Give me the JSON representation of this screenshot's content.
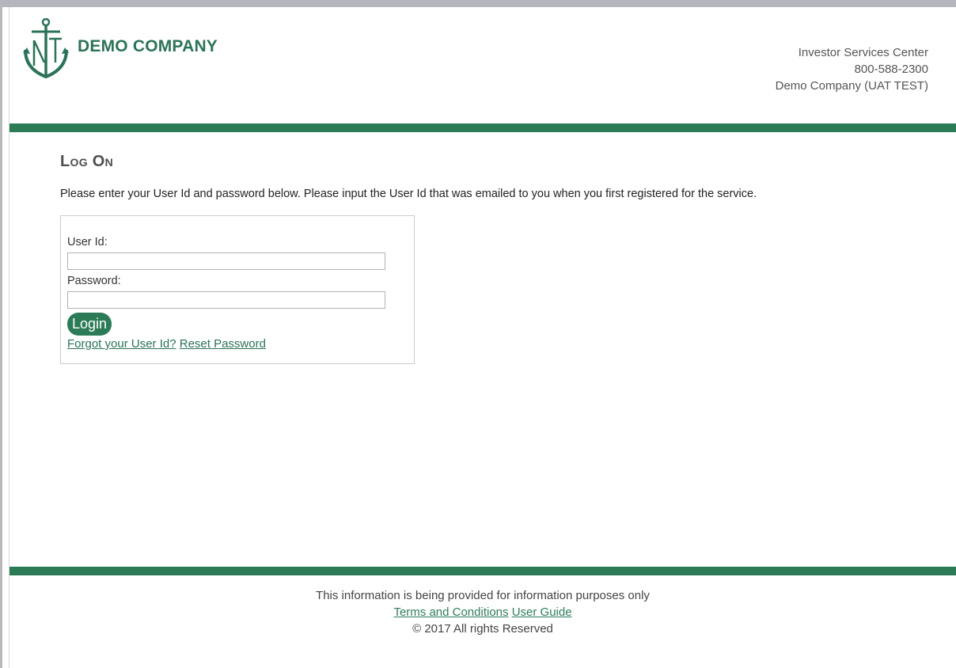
{
  "header": {
    "company_name": "DEMO COMPANY",
    "contact": {
      "center": "Investor Services Center",
      "phone": "800-588-2300",
      "entity": "Demo Company (UAT TEST)"
    }
  },
  "main": {
    "title": "Log On",
    "intro": "Please enter your User Id and password below. Please input the User Id that was emailed to you when you first registered for the service.",
    "form": {
      "user_id_label": "User Id:",
      "user_id_value": "",
      "password_label": "Password:",
      "password_value": "",
      "login_label": "Login",
      "forgot_user_id": "Forgot your User Id?",
      "reset_password": "Reset Password"
    }
  },
  "footer": {
    "disclaimer": "This information is being provided for information purposes only",
    "terms": "Terms and Conditions",
    "guide": "User Guide",
    "copyright": "© 2017 All rights Reserved"
  },
  "colors": {
    "brand_green": "#2c7b57",
    "band": "#2c7b57",
    "text": "#222222"
  },
  "icons": {
    "logo": "anchor-nt-logo-icon"
  }
}
